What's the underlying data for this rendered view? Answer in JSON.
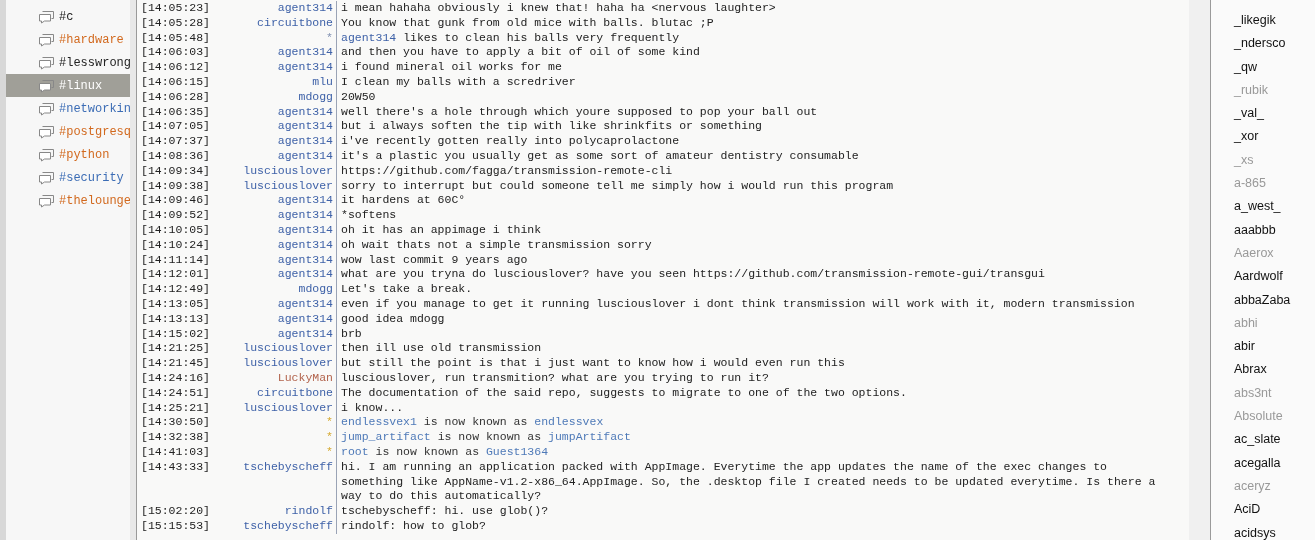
{
  "channels": [
    {
      "name": "#c",
      "selected": false
    },
    {
      "name": "#hardware",
      "color": "#d2691e",
      "selected": false
    },
    {
      "name": "#lesswrong",
      "selected": false
    },
    {
      "name": "#linux",
      "color": "#ffffff",
      "selected": true
    },
    {
      "name": "#networkin",
      "color": "#3b6cb5",
      "selected": false
    },
    {
      "name": "#postgresq",
      "color": "#d2691e",
      "selected": false
    },
    {
      "name": "#python",
      "color": "#d2691e",
      "selected": false
    },
    {
      "name": "#security",
      "color": "#3b6cb5",
      "selected": false
    },
    {
      "name": "#thelounge",
      "color": "#d2691e",
      "selected": false
    }
  ],
  "messages": [
    {
      "kind": "msg",
      "time": "[14:05:23]",
      "nick": "agent314",
      "color": "#3f62a8",
      "text": "i mean hahaha obviously i knew that! haha  ha <nervous laughter>"
    },
    {
      "kind": "msg",
      "time": "[14:05:28]",
      "nick": "circuitbone",
      "color": "#3f62a8",
      "text": "You know that gunk from old mice with balls. blutac ;P"
    },
    {
      "kind": "action",
      "time": "[14:05:48]",
      "nick": "*",
      "actor": "agent314",
      "text": "likes to clean his balls very frequently"
    },
    {
      "kind": "msg",
      "time": "[14:06:03]",
      "nick": "agent314",
      "color": "#3f62a8",
      "text": "and then you have to apply a bit of oil of some kind"
    },
    {
      "kind": "msg",
      "time": "[14:06:12]",
      "nick": "agent314",
      "color": "#3f62a8",
      "text": "i found mineral oil works for me"
    },
    {
      "kind": "msg",
      "time": "[14:06:15]",
      "nick": "mlu",
      "color": "#3f62a8",
      "text": "I clean my balls with a scredriver"
    },
    {
      "kind": "msg",
      "time": "[14:06:28]",
      "nick": "mdogg",
      "color": "#3f62a8",
      "text": "20W50"
    },
    {
      "kind": "msg",
      "time": "[14:06:35]",
      "nick": "agent314",
      "color": "#3f62a8",
      "text": "well there's a hole through which youre supposed to pop your ball out"
    },
    {
      "kind": "msg",
      "time": "[14:07:05]",
      "nick": "agent314",
      "color": "#3f62a8",
      "text": "but i always soften the tip with like shrinkfits or something"
    },
    {
      "kind": "msg",
      "time": "[14:07:37]",
      "nick": "agent314",
      "color": "#3f62a8",
      "text": "i've recently gotten really into polycaprolactone"
    },
    {
      "kind": "msg",
      "time": "[14:08:36]",
      "nick": "agent314",
      "color": "#3f62a8",
      "text": "it's a plastic you usually get as some sort of amateur dentistry consumable"
    },
    {
      "kind": "msg",
      "time": "[14:09:34]",
      "nick": "lusciouslover",
      "color": "#3f62a8",
      "text": "https://github.com/fagga/transmission-remote-cli"
    },
    {
      "kind": "msg",
      "time": "[14:09:38]",
      "nick": "lusciouslover",
      "color": "#3f62a8",
      "text": "sorry to interrupt but could someone tell me simply how i would run this program"
    },
    {
      "kind": "msg",
      "time": "[14:09:46]",
      "nick": "agent314",
      "color": "#3f62a8",
      "text": "it hardens at 60C°"
    },
    {
      "kind": "msg",
      "time": "[14:09:52]",
      "nick": "agent314",
      "color": "#3f62a8",
      "text": "*softens"
    },
    {
      "kind": "msg",
      "time": "[14:10:05]",
      "nick": "agent314",
      "color": "#3f62a8",
      "text": "oh it has an appimage i think"
    },
    {
      "kind": "msg",
      "time": "[14:10:24]",
      "nick": "agent314",
      "color": "#3f62a8",
      "text": "oh wait thats not a simple transmission sorry"
    },
    {
      "kind": "msg",
      "time": "[14:11:14]",
      "nick": "agent314",
      "color": "#3f62a8",
      "text": "wow last commit 9 years ago"
    },
    {
      "kind": "msg",
      "time": "[14:12:01]",
      "nick": "agent314",
      "color": "#3f62a8",
      "text": "what are you tryna do lusciouslover? have you seen https://github.com/transmission-remote-gui/transgui"
    },
    {
      "kind": "msg",
      "time": "[14:12:49]",
      "nick": "mdogg",
      "color": "#3f62a8",
      "text": "Let's take a break."
    },
    {
      "kind": "msg",
      "time": "[14:13:05]",
      "nick": "agent314",
      "color": "#3f62a8",
      "text": "even if you manage to get it running lusciouslover i dont think transmission will work with it, modern transmission"
    },
    {
      "kind": "msg",
      "time": "[14:13:13]",
      "nick": "agent314",
      "color": "#3f62a8",
      "text": "good idea mdogg"
    },
    {
      "kind": "msg",
      "time": "[14:15:02]",
      "nick": "agent314",
      "color": "#3f62a8",
      "text": "brb"
    },
    {
      "kind": "msg",
      "time": "[14:21:25]",
      "nick": "lusciouslover",
      "color": "#3f62a8",
      "text": "then ill use old transmission"
    },
    {
      "kind": "msg",
      "time": "[14:21:45]",
      "nick": "lusciouslover",
      "color": "#3f62a8",
      "text": "but still the point is that i just want to know how i would even run this"
    },
    {
      "kind": "msg",
      "time": "[14:24:16]",
      "nick": "LuckyMan",
      "color": "#b2634c",
      "text": "lusciouslover, run transmition? what are you trying to run it?"
    },
    {
      "kind": "msg",
      "time": "[14:24:51]",
      "nick": "circuitbone",
      "color": "#3f62a8",
      "text": "The documentation of the said repo, suggests to migrate to one of the two options."
    },
    {
      "kind": "msg",
      "time": "[14:25:21]",
      "nick": "lusciouslover",
      "color": "#3f62a8",
      "text": "i know..."
    },
    {
      "kind": "nick",
      "time": "[14:30:50]",
      "nick": "*",
      "old": "endlessvex1",
      "text": "is now known as",
      "new": "endlessvex"
    },
    {
      "kind": "nick",
      "time": "[14:32:38]",
      "nick": "*",
      "old": "jump_artifact",
      "text": "is now known as",
      "new": "jumpArtifact"
    },
    {
      "kind": "nick",
      "time": "[14:41:03]",
      "nick": "*",
      "old": "root",
      "text": "is now known as",
      "new": "Guest1364"
    },
    {
      "kind": "msg",
      "time": "[14:43:33]",
      "nick": "tschebyscheff",
      "color": "#3f62a8",
      "text": "hi. I am running an application packed with AppImage. Everytime the app updates the name of the exec changes to something like AppName-v1.2-x86_64.AppImage. So, the .desktop file I created needs to be updated everytime. Is there a way to do this automatically?"
    },
    {
      "kind": "msg",
      "time": "[15:02:20]",
      "nick": "rindolf",
      "color": "#3f62a8",
      "text": "tschebyscheff: hi. use glob()?"
    },
    {
      "kind": "msg",
      "time": "[15:15:53]",
      "nick": "tschebyscheff",
      "color": "#3f62a8",
      "text": "rindolf: how to glob?"
    }
  ],
  "users": [
    {
      "name": "_likegik",
      "away": false
    },
    {
      "name": "_ndersco",
      "away": false
    },
    {
      "name": "_qw",
      "away": false
    },
    {
      "name": "_rubik",
      "away": true
    },
    {
      "name": "_val_",
      "away": false
    },
    {
      "name": "_xor",
      "away": false
    },
    {
      "name": "_xs",
      "away": true
    },
    {
      "name": "a-865",
      "away": true
    },
    {
      "name": "a_west_",
      "away": false
    },
    {
      "name": "aaabbb",
      "away": false
    },
    {
      "name": "Aaerox",
      "away": true
    },
    {
      "name": "Aardwolf",
      "away": false
    },
    {
      "name": "abbaZaba",
      "away": false
    },
    {
      "name": "abhi",
      "away": true
    },
    {
      "name": "abir",
      "away": false
    },
    {
      "name": "Abrax",
      "away": false
    },
    {
      "name": "abs3nt",
      "away": true
    },
    {
      "name": "Absolute",
      "away": true
    },
    {
      "name": "ac_slate",
      "away": false
    },
    {
      "name": "acegalla",
      "away": false
    },
    {
      "name": "aceryz",
      "away": true
    },
    {
      "name": "AciD",
      "away": false
    },
    {
      "name": "acidsys",
      "away": false
    }
  ]
}
